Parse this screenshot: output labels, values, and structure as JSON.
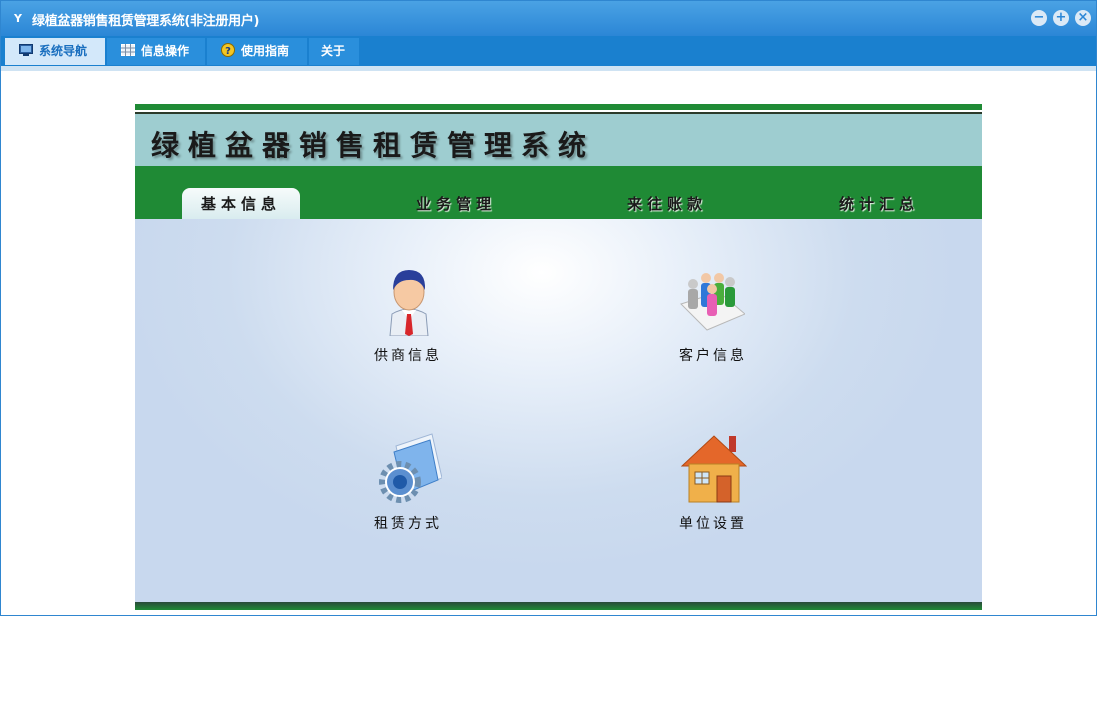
{
  "window": {
    "title": "绿植盆器销售租赁管理系统(非注册用户)",
    "app_icon_glyph": "Y",
    "controls": [
      "minimize-icon",
      "maximize-icon",
      "close-icon"
    ]
  },
  "menubar": {
    "items": [
      {
        "label": "系统导航",
        "icon": "monitor-icon",
        "active": true
      },
      {
        "label": "信息操作",
        "icon": "grid-icon",
        "active": false
      },
      {
        "label": "使用指南",
        "icon": "help-icon",
        "active": false
      },
      {
        "label": "关于",
        "icon": "",
        "active": false
      }
    ]
  },
  "panel": {
    "banner_title": "绿植盆器销售租赁管理系统",
    "tabs": [
      {
        "label": "基本信息",
        "active": true
      },
      {
        "label": "业务管理",
        "active": false
      },
      {
        "label": "来往账款",
        "active": false
      },
      {
        "label": "统计汇总",
        "active": false
      }
    ],
    "tiles": [
      {
        "label": "供商信息",
        "icon": "supplier-person-icon"
      },
      {
        "label": "客户信息",
        "icon": "customer-group-icon"
      },
      {
        "label": "租赁方式",
        "icon": "lease-gear-document-icon"
      },
      {
        "label": "单位设置",
        "icon": "house-icon"
      }
    ]
  },
  "colors": {
    "titlebar": "#2b86d6",
    "menubar": "#1a80cf",
    "green_band": "#1f8a35",
    "banner": "#9ecdd0",
    "content_bg": "#cddcef"
  }
}
